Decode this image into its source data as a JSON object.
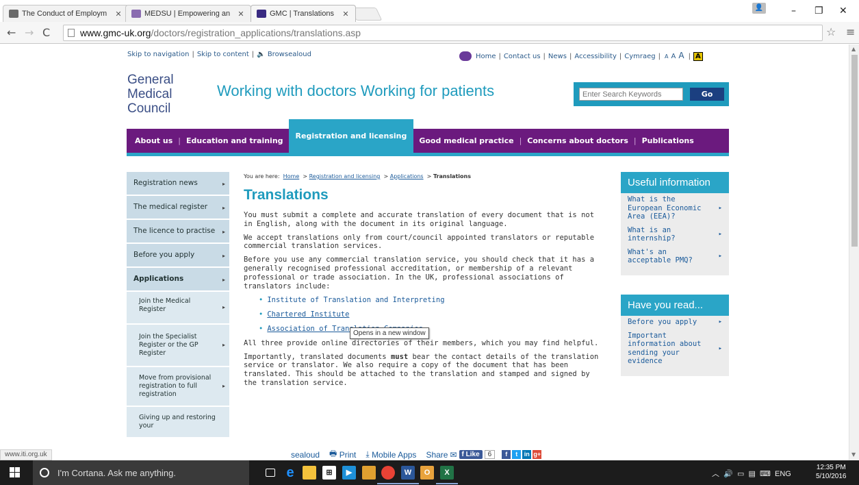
{
  "browser": {
    "tabs": [
      {
        "label": "The Conduct of Employm",
        "active": false
      },
      {
        "label": "MEDSU | Empowering an",
        "active": false
      },
      {
        "label": "GMC | Translations",
        "active": true
      }
    ],
    "url_host": "www.gmc-uk.org",
    "url_path": "/doctors/registration_applications/translations.asp",
    "status_url": "www.iti.org.uk"
  },
  "page": {
    "utility": {
      "skip_nav": "Skip to navigation",
      "skip_content": "Skip to content",
      "browsealoud": "Browsealoud",
      "home": "Home",
      "contact": "Contact us",
      "news": "News",
      "accessibility": "Accessibility",
      "cymraeg": "Cymraeg",
      "text_sizes": [
        "A",
        "A",
        "A"
      ],
      "high_contrast": "A"
    },
    "logo": [
      "General",
      "Medical",
      "Council"
    ],
    "tagline": "Working with doctors Working for patients",
    "search": {
      "placeholder": "Enter Search Keywords",
      "button": "Go"
    },
    "main_nav": [
      "About us",
      "Education and training",
      "Registration and licensing",
      "Good medical practice",
      "Concerns about doctors",
      "Publications"
    ],
    "left_nav": [
      "Registration news",
      "The medical register",
      "The licence to practise",
      "Before you apply",
      "Applications",
      "Join the Medical Register",
      "Join the Specialist Register or the GP Register",
      "Move from provisional registration to full registration",
      "Giving up and restoring your"
    ],
    "breadcrumb": {
      "prefix": "You are here:",
      "home": "Home",
      "section": "Registration and licensing",
      "subsection": "Applications",
      "current": "Translations"
    },
    "title": "Translations",
    "paragraphs": [
      "You must submit a complete and accurate translation of every document that is not in English, along with the document in its original language.",
      "We accept translations only from court/council appointed translators or reputable commercial translation services.",
      "Before you use any commercial translation service, you should check that it has a generally recognised professional accreditation, or membership of a relevant professional or trade association. In the UK, professional associations of translators include:"
    ],
    "links": [
      "Institute of Translation and Interpreting",
      "Chartered Institute",
      "Association of Translation Companies"
    ],
    "tooltip": "Opens in a new window",
    "para_after": "All three provide online directories of their members, which you may find helpful.",
    "para_final_before": "Importantly, translated documents ",
    "para_final_bold": "must",
    "para_final_after": " bear the contact details of the translation service or translator. We also require a copy of the document that has been translated. This should be attached to the translation and stamped and signed by the translation service.",
    "share": {
      "browsealoud": "sealoud",
      "print": "Print",
      "mobile": "Mobile Apps",
      "share": "Share",
      "like": "Like",
      "like_count": "6"
    },
    "useful": {
      "title": "Useful information",
      "items": [
        "What is the European Economic Area (EEA)?",
        "What is an internship?",
        "What's an acceptable PMQ?"
      ]
    },
    "haveyouread": {
      "title": "Have you read...",
      "items": [
        "Before you apply",
        "Important information about sending your evidence"
      ]
    }
  },
  "taskbar": {
    "cortana": "I'm Cortana. Ask me anything.",
    "lang": "ENG",
    "time": "12:35 PM",
    "date": "5/10/2016"
  },
  "colors": {
    "purple_nav": "#6b1a7e",
    "teal": "#2aa5c7",
    "link": "#1a5a9a"
  }
}
